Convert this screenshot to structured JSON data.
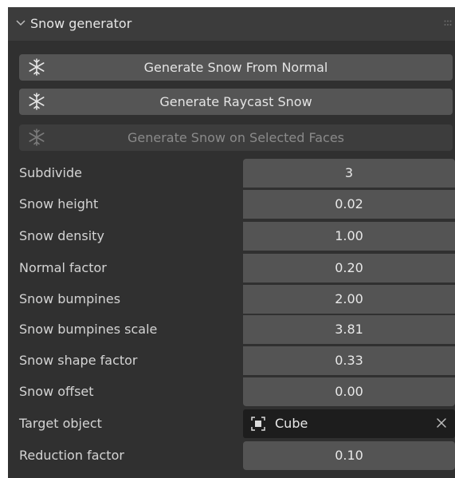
{
  "panel": {
    "title": "Snow generator",
    "icons": {
      "collapse": "chevron-down-icon",
      "drag": "drag-handle-icon",
      "button": "snowflake-icon"
    }
  },
  "buttons": [
    {
      "label": "Generate Snow From Normal",
      "enabled": true
    },
    {
      "label": "Generate Raycast Snow",
      "enabled": true
    },
    {
      "label": "Generate Snow on Selected Faces",
      "enabled": false
    }
  ],
  "properties": {
    "subdivide": {
      "label": "Subdivide",
      "value": "3"
    },
    "snow_height": {
      "label": "Snow height",
      "value": "0.02"
    },
    "snow_density": {
      "label": "Snow density",
      "value": "1.00"
    },
    "normal_factor": {
      "label": "Normal factor",
      "value": "0.20"
    },
    "snow_bumpines": {
      "label": "Snow bumpines",
      "value": "2.00"
    },
    "snow_bumpines_scale": {
      "label": "Snow bumpines scale",
      "value": "3.81"
    },
    "snow_shape_factor": {
      "label": "Snow shape factor",
      "value": "0.33"
    },
    "snow_offset": {
      "label": "Snow offset",
      "value": "0.00"
    },
    "target_object": {
      "label": "Target object",
      "value": "Cube",
      "icon": "object-icon"
    },
    "reduction_factor": {
      "label": "Reduction factor",
      "value": "0.10"
    }
  },
  "colors": {
    "panel_bg": "#303030",
    "header_bg": "#3c3c3c",
    "button_bg": "#555555",
    "field_bg": "#545454",
    "object_field_bg": "#1d1d1d"
  }
}
